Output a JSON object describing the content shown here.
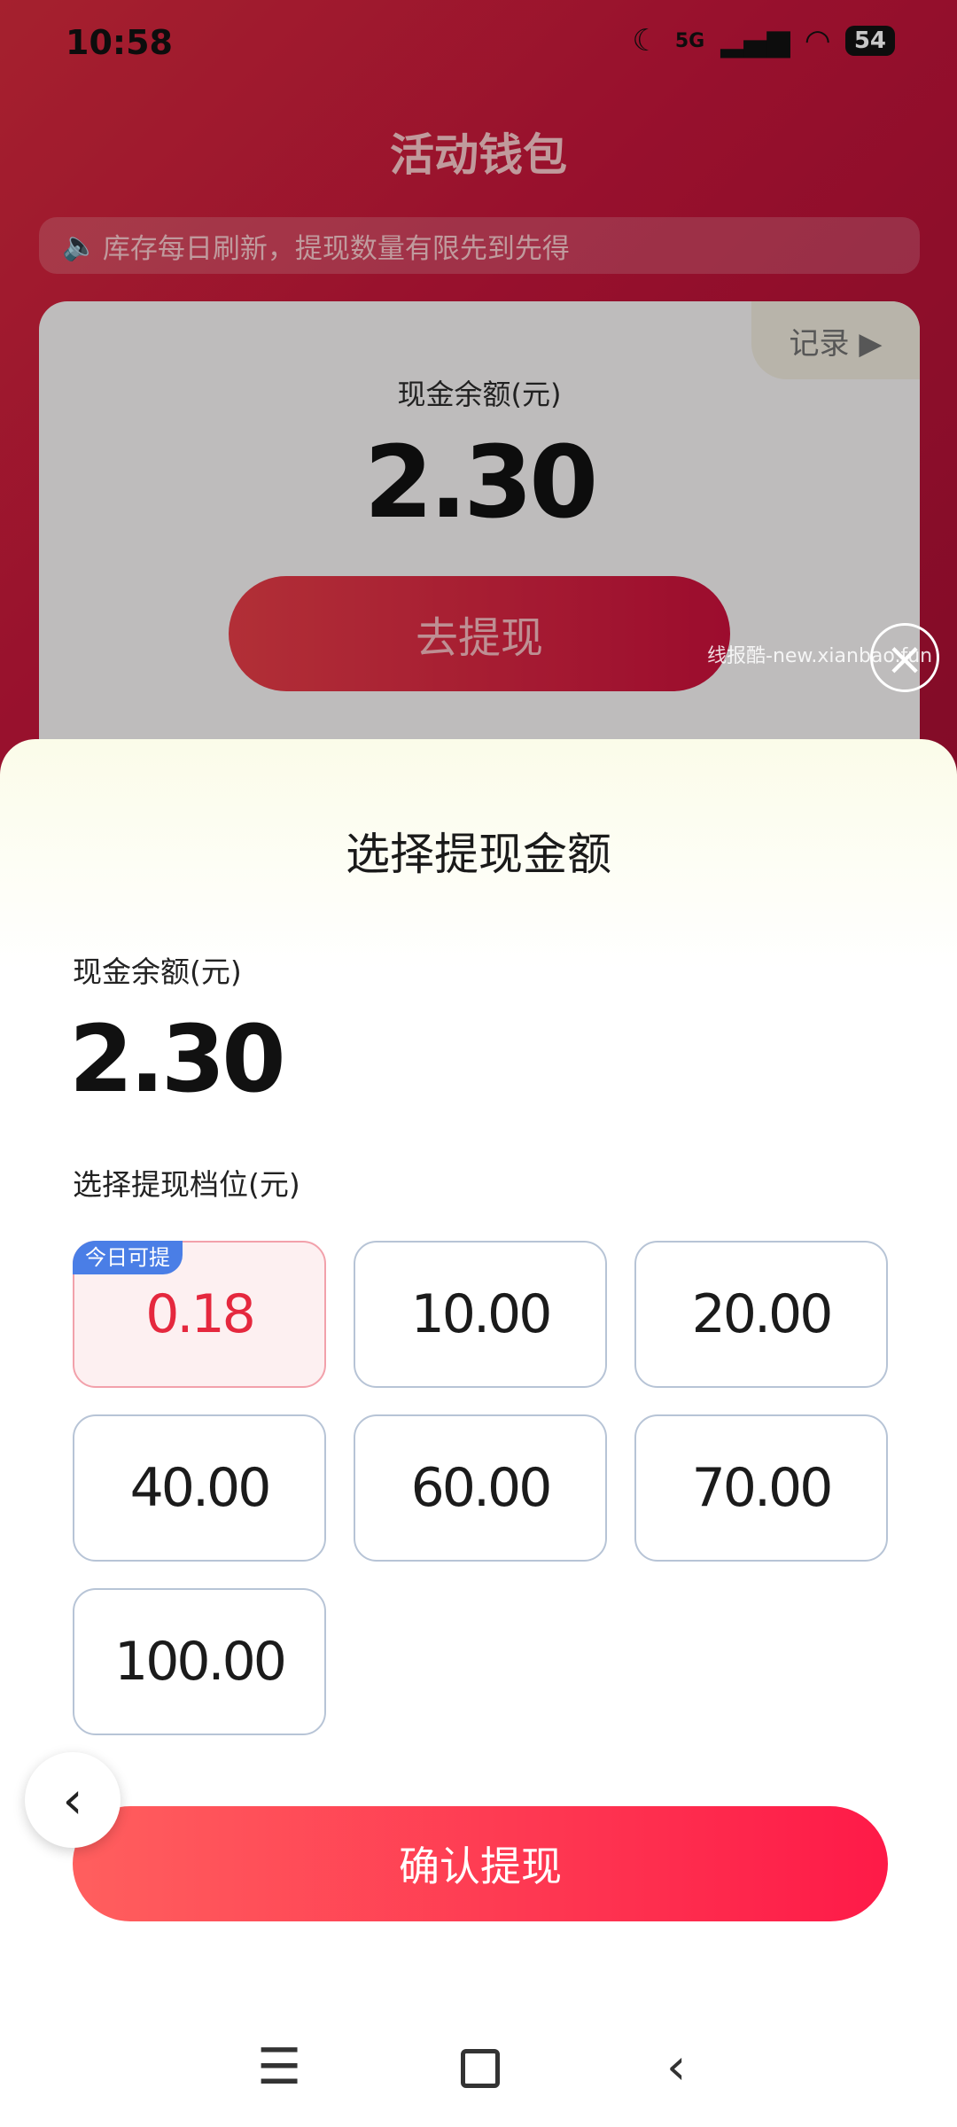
{
  "status_bar": {
    "time": "10:58",
    "network": "5G",
    "battery": "54"
  },
  "app": {
    "title": "活动钱包",
    "notice": "库存每日刷新，提现数量有限先到先得",
    "record_label": "记录 ▶",
    "card_balance_label": "现金余额(元)",
    "card_balance_value": "2.30",
    "withdraw_button": "去提现",
    "watermark": "线报酷-new.xianbao.fun"
  },
  "sheet": {
    "title": "选择提现金额",
    "balance_label": "现金余额(元)",
    "balance_value": "2.30",
    "tier_label": "选择提现档位(元)",
    "tiers": [
      {
        "amount": "0.18",
        "badge": "今日可提",
        "selected": true
      },
      {
        "amount": "10.00"
      },
      {
        "amount": "20.00"
      },
      {
        "amount": "40.00"
      },
      {
        "amount": "60.00"
      },
      {
        "amount": "70.00"
      },
      {
        "amount": "100.00"
      }
    ],
    "confirm_button": "确认提现"
  },
  "icons": {
    "close": "close-icon",
    "back_float": "chevron-left-icon",
    "speaker": "speaker-icon"
  },
  "colors": {
    "header_red": "#c2153a",
    "accent_red": "#fe1a48",
    "badge_blue": "#4a7ee6",
    "selected_text": "#e5283e"
  }
}
